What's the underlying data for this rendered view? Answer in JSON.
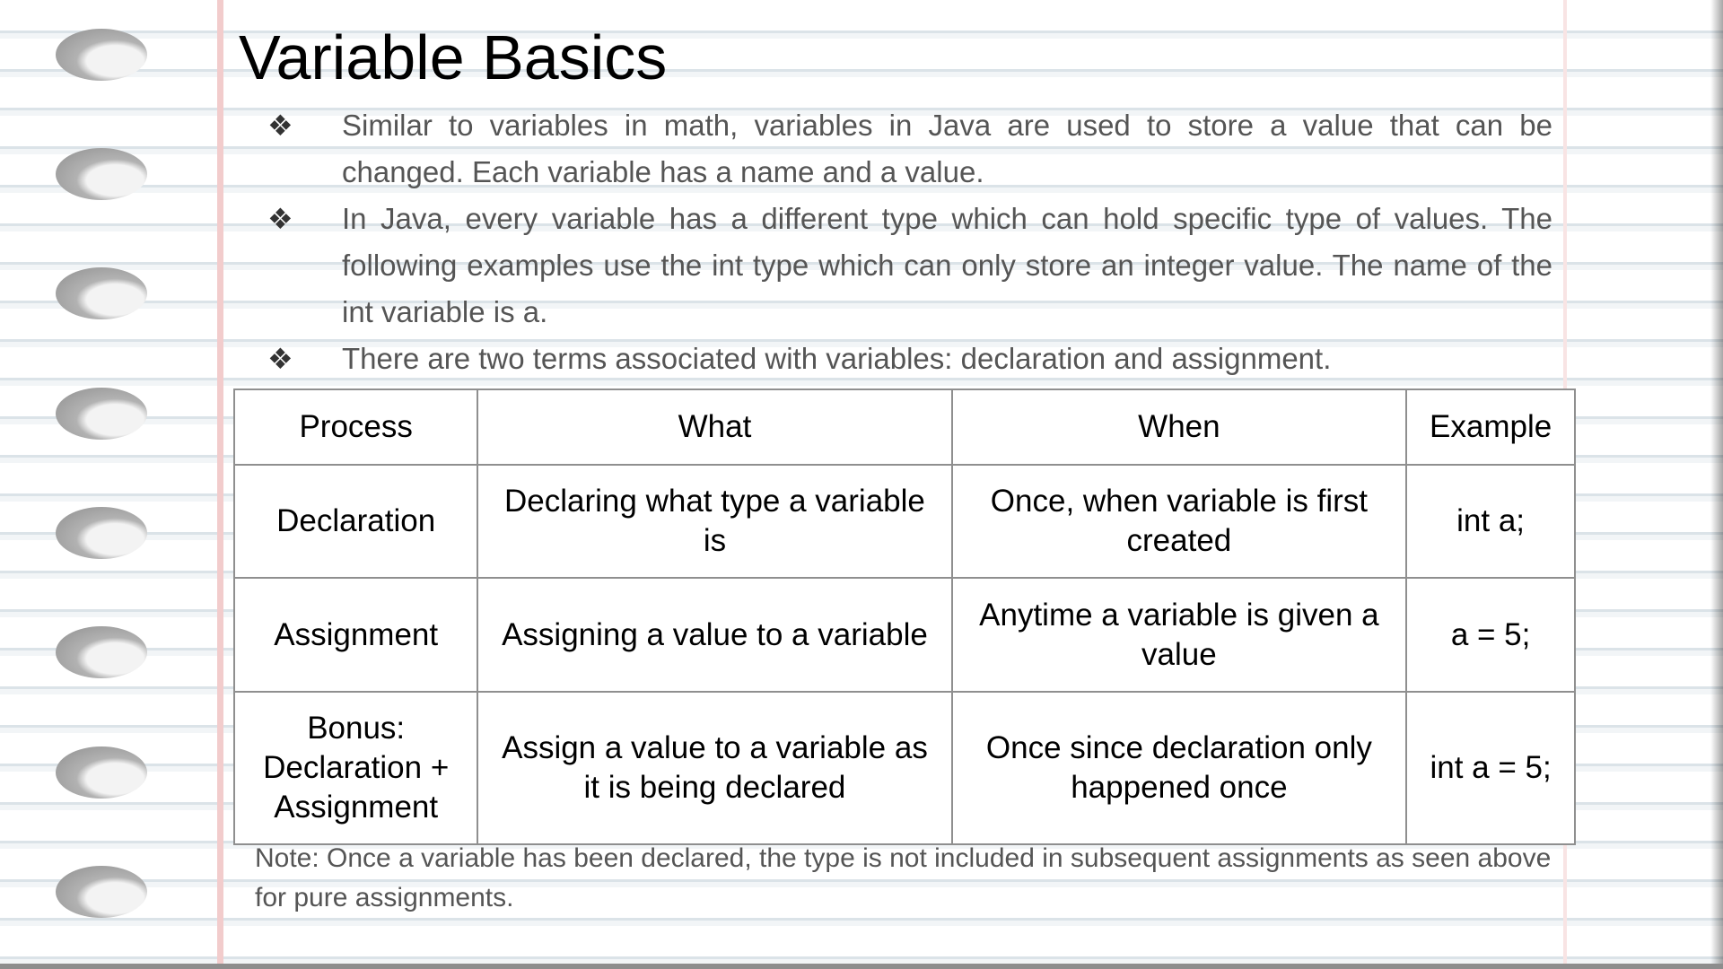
{
  "title": "Variable Basics",
  "bullet_glyph": "❖",
  "bullets": [
    "Similar to variables in math, variables in Java are used to store a value that can be changed. Each variable has a name and a value.",
    "In Java, every variable has a different type which can hold specific type of values. The following examples use the int type which can only store an integer value. The name of the int variable is a.",
    "There are two terms associated with variables: declaration and assignment."
  ],
  "table": {
    "headers": [
      "Process",
      "What",
      "When",
      "Example"
    ],
    "rows": [
      [
        "Declaration",
        "Declaring what type a variable is",
        "Once, when variable is first created",
        "int a;"
      ],
      [
        "Assignment",
        "Assigning a value to a variable",
        "Anytime a variable is given a value",
        "a = 5;"
      ],
      [
        "Bonus: Declaration + Assignment",
        "Assign a value to a variable as it is being declared",
        "Once since declaration only happened once",
        "int a = 5;"
      ]
    ]
  },
  "note": "Note: Once a variable has been declared, the type is not included in subsequent assignments as seen above for pure assignments."
}
